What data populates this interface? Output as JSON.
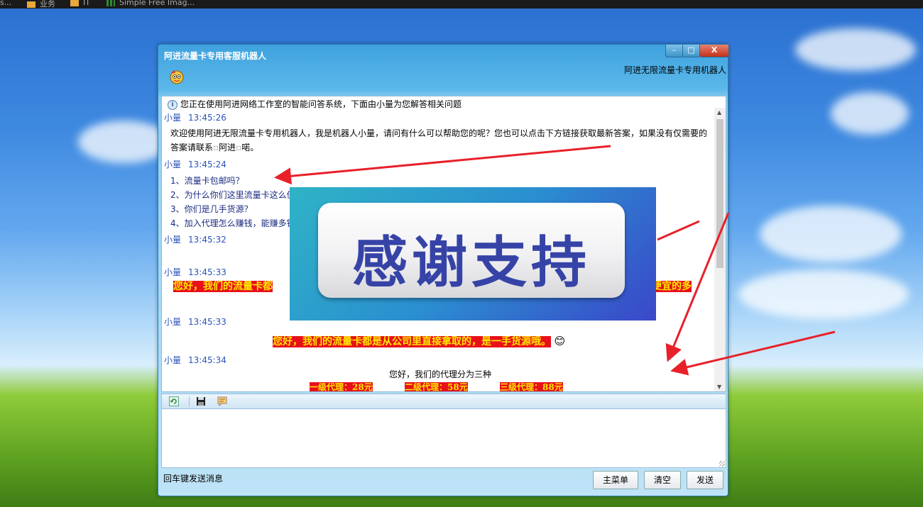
{
  "taskbar": {
    "items": [
      "s...",
      "业务",
      "IT",
      "Simple Free Imag..."
    ]
  },
  "window": {
    "title": "阿进流量卡专用客服机器人",
    "subtitle": "阿进无限流量卡专用机器人",
    "controls": {
      "minimize": "–",
      "maximize": "□",
      "close": "X"
    }
  },
  "chat": {
    "info": "您正在使用阿进网络工作室的智能问答系统，下面由小量为您解答相关问题",
    "messages": [
      {
        "sender": "小量",
        "time": "13:45:26",
        "text_line1": "欢迎使用阿进无限流量卡专用机器人，我是机器人小量，请问有什么可以帮助您的呢？您也可以点击下方链接获取最新答案，如果没有仅需要的",
        "text_line2": "答案请联系",
        "text_contact": "阿进",
        "text_end": "喏。"
      },
      {
        "sender": "小量",
        "time": "13:45:24",
        "questions": [
          "1、流量卡包邮吗？",
          "2、为什么你们这里流量卡这么便",
          "3、你们是几手货源？",
          "4、加入代理怎么赚钱，能赚多钱"
        ]
      },
      {
        "sender": "小量",
        "time": "13:45:32"
      },
      {
        "sender": "小量",
        "time": "13:45:33",
        "hl_left": "您好，我们的流量卡都",
        "hl_right": "便宜的多"
      },
      {
        "sender": "小量",
        "time": "13:45:33",
        "hl_center": "您好，我们的流量卡都是从公司里直接拿取的，是一手货源哦。",
        "emoji": "😊"
      },
      {
        "sender": "小量",
        "time": "13:45:34",
        "center_text": "您好，我们的代理分为三种",
        "tiers": [
          "一级代理：28元",
          "二级代理：58元",
          "三级代理：88元"
        ]
      }
    ]
  },
  "overlay": {
    "text": "感谢支持"
  },
  "footer": {
    "hint": "回车键发送消息",
    "buttons": {
      "menu": "主菜单",
      "clear": "清空",
      "send": "发送"
    }
  },
  "colors": {
    "highlight_bg": "#e8101a",
    "highlight_fg": "#ffe600",
    "sender": "#2a52b8",
    "arrow": "#e8202a"
  }
}
